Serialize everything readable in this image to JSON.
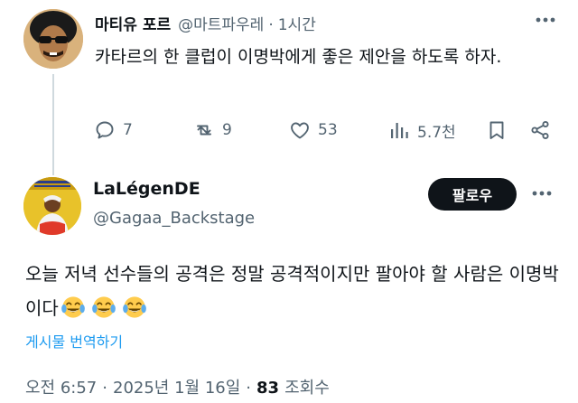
{
  "reply_tweet": {
    "author_name": "마티유 포르",
    "handle": "@마트파우레",
    "separator": "·",
    "time_ago": "1시간",
    "text": "카타르의 한 클럽이 이명박에게 좋은 제안을 하도록 하자.",
    "actions": {
      "replies": "7",
      "retweets": "9",
      "likes": "53",
      "views": "5.7천"
    }
  },
  "main_tweet": {
    "author_name": "LaLégenDE",
    "handle": "@Gagaa_Backstage",
    "follow_label": "팔로우",
    "text": "오늘 저녁 선수들의 공격은 정말 공격적이지만 팔아야 할 사람은 이명박이다",
    "emojis": [
      "face-with-tears-of-joy-icon",
      "face-with-tears-of-joy-icon",
      "face-with-tears-of-joy-icon"
    ],
    "translate_label": "게시물 번역하기",
    "time": "오전 6:57",
    "separator": "·",
    "date": "2025년 1월 16일",
    "views_count": "83",
    "views_label": "조회수"
  },
  "colors": {
    "text_primary": "#0f1419",
    "text_secondary": "#536471",
    "link": "#1d9bf0",
    "follow_bg": "#0f1419"
  }
}
